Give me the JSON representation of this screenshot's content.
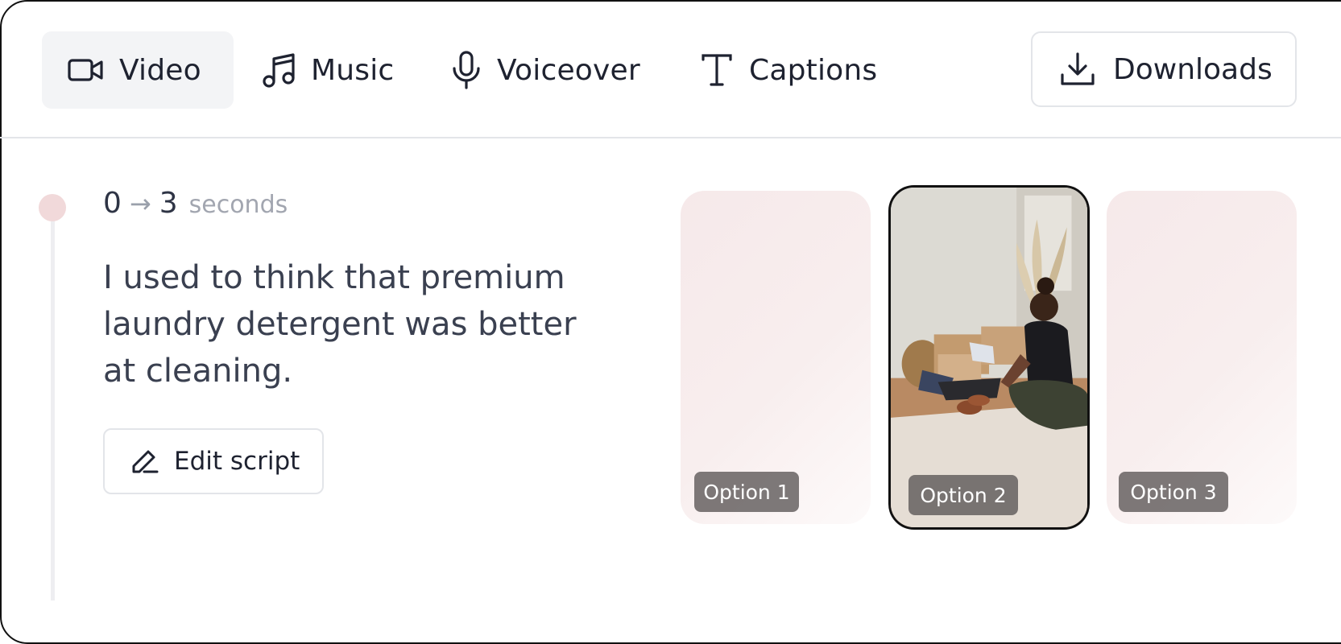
{
  "tabs": [
    {
      "label": "Video",
      "icon": "video-camera-icon",
      "active": true
    },
    {
      "label": "Music",
      "icon": "music-note-icon",
      "active": false
    },
    {
      "label": "Voiceover",
      "icon": "microphone-icon",
      "active": false
    },
    {
      "label": "Captions",
      "icon": "text-t-icon",
      "active": false
    }
  ],
  "downloads": {
    "label": "Downloads",
    "icon": "download-icon"
  },
  "segment": {
    "start": "0",
    "arrow": "→",
    "end": "3",
    "unit": "seconds",
    "script": "I used to think that premium laundry detergent was better at cleaning.",
    "edit_label": "Edit script"
  },
  "options": [
    {
      "label": "Option 1",
      "selected": false
    },
    {
      "label": "Option 2",
      "selected": true
    },
    {
      "label": "Option 3",
      "selected": false
    }
  ],
  "colors": {
    "accent_dot": "#f1d9da",
    "placeholder_tint": "#f6e9ea",
    "active_tab_bg": "#f3f4f6"
  }
}
